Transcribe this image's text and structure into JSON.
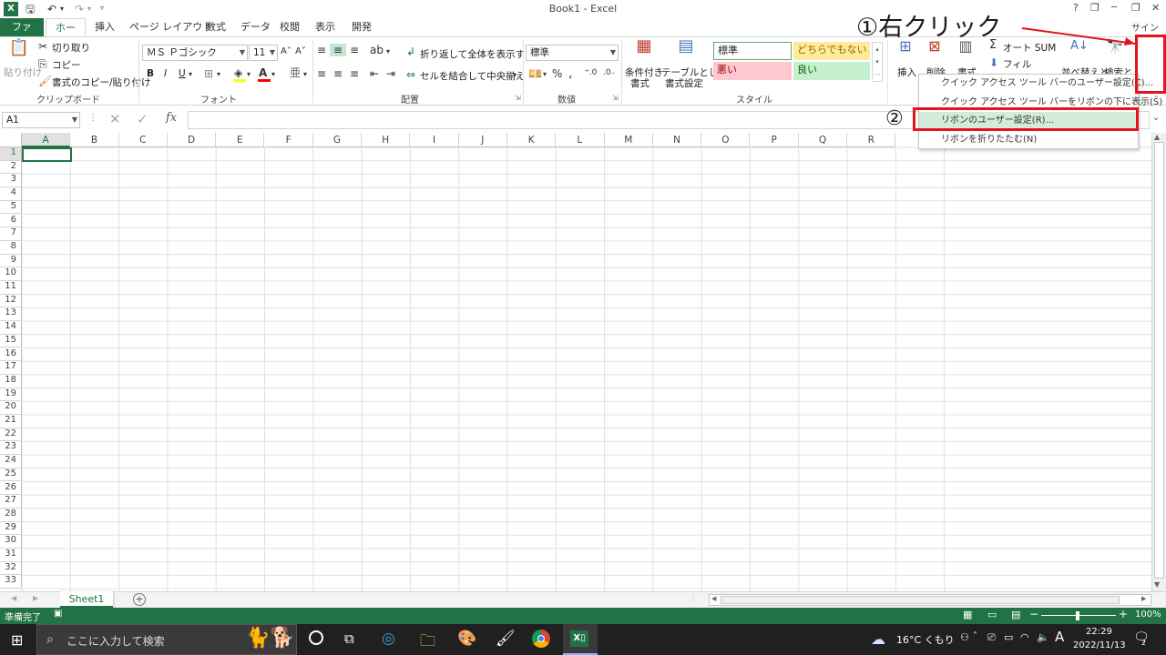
{
  "titlebar": {
    "title": "Book1 - Excel",
    "help": "?",
    "minimize": "─",
    "restore": "❐",
    "close": "✕",
    "signin": "サインイン"
  },
  "tabs": [
    {
      "label": "ファイル"
    },
    {
      "label": "ホーム"
    },
    {
      "label": "挿入"
    },
    {
      "label": "ページ レイアウト"
    },
    {
      "label": "数式"
    },
    {
      "label": "データ"
    },
    {
      "label": "校閲"
    },
    {
      "label": "表示"
    },
    {
      "label": "開発"
    }
  ],
  "ribbon": {
    "clipboard": {
      "paste": "貼り付け",
      "cut": "切り取り",
      "copy": "コピー",
      "format_painter": "書式のコピー/貼り付け",
      "group": "クリップボード"
    },
    "font": {
      "name": "ＭＳ Ｐゴシック",
      "size": "11",
      "bold": "B",
      "italic": "I",
      "underline": "U",
      "group": "フォント"
    },
    "alignment": {
      "wrap": "折り返して全体を表示する",
      "merge": "セルを結合して中央揃え",
      "group": "配置"
    },
    "number": {
      "format": "標準",
      "group": "数値"
    },
    "styles": {
      "conditional": "条件付き",
      "conditional2": "書式",
      "as_table": "テーブルとして",
      "as_table2": "書式設定",
      "normal": "標準",
      "neutral": "どちらでもない",
      "bad": "悪い",
      "good": "良い",
      "group": "スタイル"
    },
    "cells": {
      "insert": "挿入",
      "delete": "削除",
      "format": "書式"
    },
    "editing": {
      "autosum": "オート SUM",
      "fill": "フィル",
      "sort": "並べ替えと",
      "find": "検索と"
    }
  },
  "formula": {
    "namebox": "A1",
    "fx": "fx"
  },
  "columns": [
    "A",
    "B",
    "C",
    "D",
    "E",
    "F",
    "G",
    "H",
    "I",
    "J",
    "K",
    "L",
    "M",
    "N",
    "O",
    "P",
    "Q",
    "R"
  ],
  "rows": [
    "1",
    "2",
    "3",
    "4",
    "5",
    "6",
    "7",
    "8",
    "9",
    "10",
    "11",
    "12",
    "13",
    "14",
    "15",
    "16",
    "17",
    "18",
    "19",
    "20",
    "21",
    "22",
    "23",
    "24",
    "25",
    "26",
    "27",
    "28",
    "29",
    "30",
    "31",
    "32",
    "33"
  ],
  "sheet": {
    "tab": "Sheet1",
    "add": "+"
  },
  "status": {
    "ready": "準備完了",
    "zoom": "100%"
  },
  "context_menu": {
    "items": [
      {
        "label": "クイック アクセス ツール バーのユーザー設定(C)..."
      },
      {
        "label": "クイック アクセス ツール バーをリボンの下に表示(S)"
      },
      {
        "label": "リボンのユーザー設定(R)..."
      },
      {
        "label": "リボンを折りたたむ(N)"
      }
    ]
  },
  "annotations": {
    "step1": "①右クリック",
    "step2": "②"
  },
  "taskbar": {
    "search_placeholder": "ここに入力して検索",
    "weather": "16°C くもり",
    "ime": "A",
    "time": "22:29",
    "date": "2022/11/13",
    "notif_count": "2"
  },
  "colors": {
    "excel_green": "#217346",
    "annotation_red": "#e3141b",
    "menu_highlight": "#d3ecd9",
    "bad_fill": "#ffc7ce",
    "good_fill": "#c6efce",
    "neutral_fill": "#ffeb9c"
  }
}
